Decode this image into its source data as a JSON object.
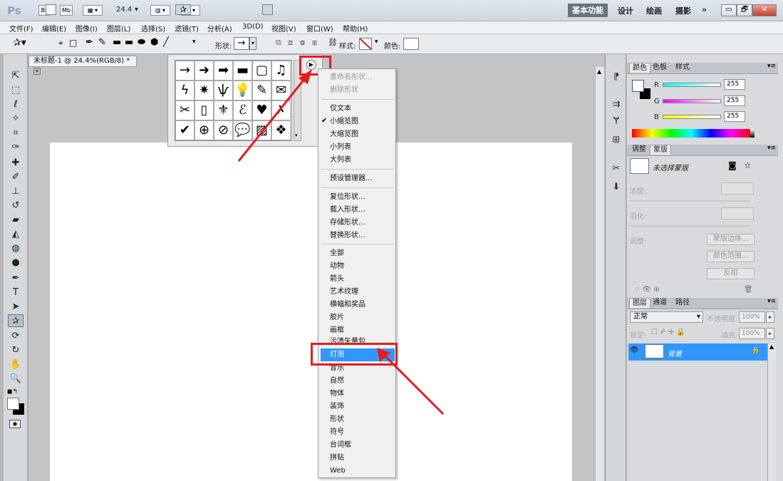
{
  "app": {
    "logo": "Ps",
    "br": "Br",
    "mb": "Mb",
    "zoom": "24.4"
  },
  "workspaces": {
    "active": "基本功能",
    "items": [
      "设计",
      "绘画",
      "摄影"
    ],
    "more": "»"
  },
  "window_buttons": {
    "minimize": "▭",
    "restore": "🗗",
    "close": "✕"
  },
  "menu": [
    "文件(F)",
    "编辑(E)",
    "图像(I)",
    "图层(L)",
    "选择(S)",
    "滤镜(T)",
    "分析(A)",
    "3D(D)",
    "视图(V)",
    "窗口(W)",
    "帮助(H)"
  ],
  "options": {
    "shape_label": "形状:",
    "style_label": "样式:",
    "color_label": "颜色:"
  },
  "document": {
    "tab": "未标题-1 @ 24.4%(RGB/8) *"
  },
  "shape_grid": [
    "→",
    "➜",
    "➡",
    "▬",
    "▢",
    "♫",
    "ϟ",
    "✷",
    "ѱ",
    "💡",
    "✎",
    "✉",
    "✂",
    "▯",
    "⚜",
    "ℰ",
    "♥",
    "✗",
    "✔",
    "⊕",
    "⊘",
    "💬",
    "▨",
    "❖"
  ],
  "context_menu": {
    "group1": [
      "重命名形状...",
      "删除形状"
    ],
    "group2": [
      "仅文本",
      "小缩览图",
      "大缩览图",
      "小列表",
      "大列表"
    ],
    "checked": "小缩览图",
    "group3": [
      "预设管理器..."
    ],
    "group4": [
      "复位形状...",
      "载入形状...",
      "存储形状...",
      "替换形状..."
    ],
    "group5": [
      "全部",
      "动物",
      "箭头",
      "艺术纹理",
      "横幅和奖品",
      "胶片",
      "画框",
      "污渍矢量包",
      "灯泡",
      "音乐",
      "自然",
      "物体",
      "装饰",
      "形状",
      "符号",
      "台词框",
      "拼贴",
      "Web"
    ],
    "highlighted": "灯泡"
  },
  "color_panel": {
    "tabs": [
      "颜色",
      "色板",
      "样式"
    ],
    "rows": [
      {
        "label": "R",
        "value": "255"
      },
      {
        "label": "G",
        "value": "255"
      },
      {
        "label": "B",
        "value": "255"
      }
    ]
  },
  "adjust_panel": {
    "tabs": [
      "调整",
      "蒙版"
    ],
    "mask_label": "未选择蒙版",
    "density": "浓度:",
    "feather": "羽化:",
    "refine": "调整:",
    "buttons": [
      "蒙版边缘...",
      "颜色范围...",
      "反相"
    ]
  },
  "layers_panel": {
    "tabs": [
      "图层",
      "通道",
      "路径"
    ],
    "blend": "正常",
    "opacity_label": "不透明度:",
    "opacity": "100%",
    "lock_label": "锁定:",
    "fill_label": "填充:",
    "fill": "100%",
    "layer_name": "背景"
  },
  "colors": {
    "accent": "#3197fc",
    "annotation": "#e41d1d"
  }
}
